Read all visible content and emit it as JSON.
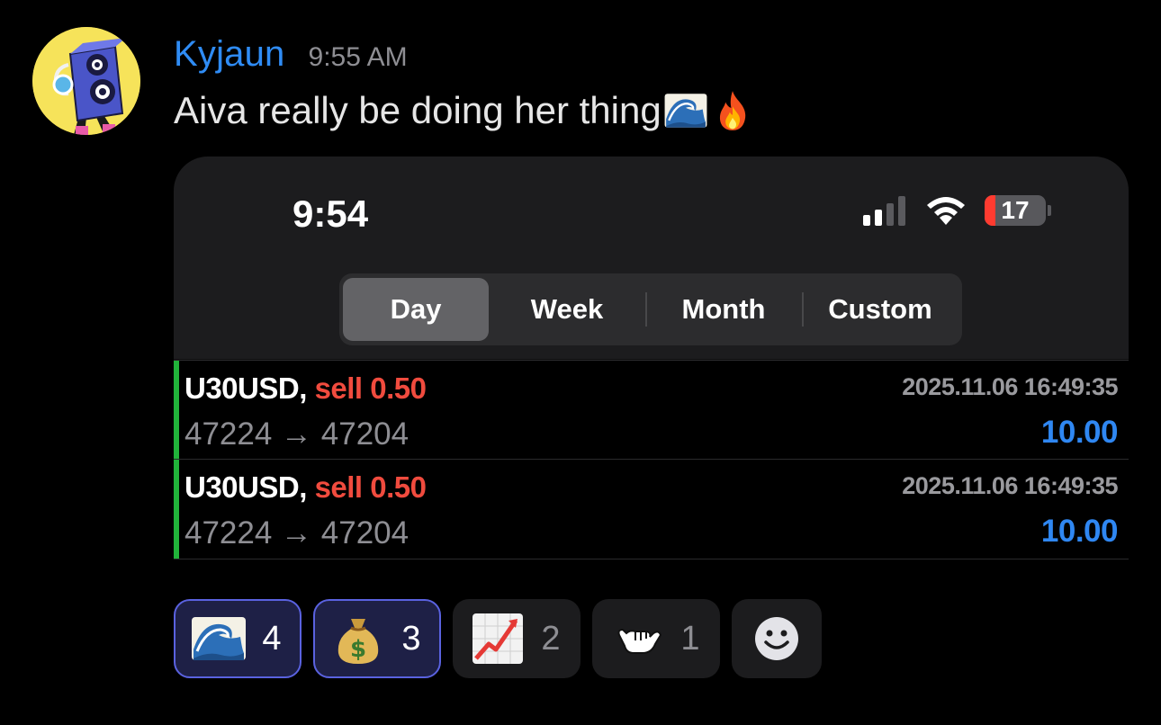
{
  "message": {
    "author": "Kyjaun",
    "time": "9:55 AM",
    "text": "Aiva really be doing her thing",
    "inline_emojis": [
      "water-wave-emoji",
      "fire-emoji"
    ],
    "author_color": "#2f8cf5"
  },
  "attachment": {
    "status_bar": {
      "time": "9:54",
      "battery": "17",
      "signal_bars_active": 2
    },
    "segmented_control": {
      "items": [
        "Day",
        "Week",
        "Month",
        "Custom"
      ],
      "selected": "Day"
    },
    "trades": [
      {
        "symbol": "U30USD,",
        "side": "sell 0.50",
        "prices": "47224 → 47204",
        "time": "2025.11.06 16:49:35",
        "profit": "10.00"
      },
      {
        "symbol": "U30USD,",
        "side": "sell 0.50",
        "prices": "47224 → 47204",
        "time": "2025.11.06 16:49:35",
        "profit": "10.00"
      }
    ]
  },
  "reactions": [
    {
      "emoji": "water-wave-emoji",
      "count": "4",
      "selected": true
    },
    {
      "emoji": "money-bag-emoji",
      "count": "3",
      "selected": true
    },
    {
      "emoji": "chart-increasing-emoji",
      "count": "2",
      "selected": false
    },
    {
      "emoji": "shaka-hand-emoji",
      "count": "1",
      "selected": false
    }
  ],
  "add_reaction_icon": "add-reaction-smiley-icon"
}
